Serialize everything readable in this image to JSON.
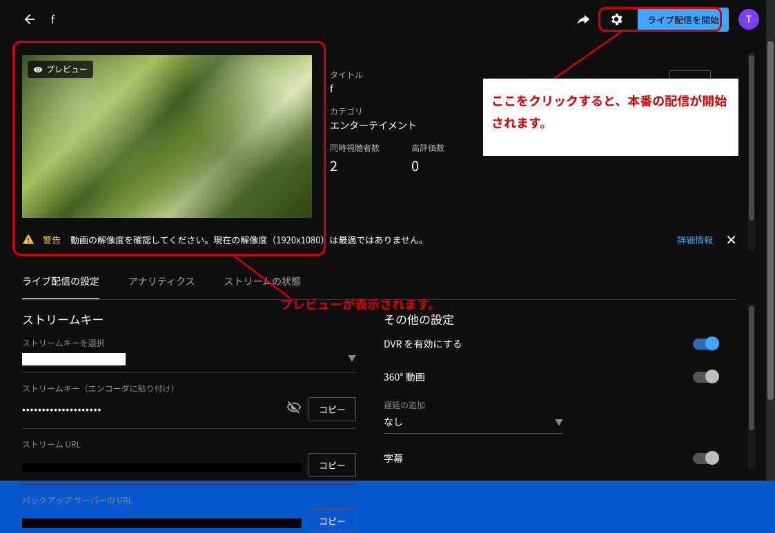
{
  "topbar": {
    "stream_title": "f",
    "go_live_label": "ライブ配信を開始",
    "avatar_initial": "T"
  },
  "preview": {
    "badge": "プレビュー"
  },
  "meta": {
    "title_label": "タイトル",
    "title_value": "f",
    "category_label": "カテゴリ",
    "category_value": "エンターテイメント",
    "viewers_label": "同時視聴者数",
    "viewers_value": "2",
    "likes_label": "高評価数",
    "likes_value": "0"
  },
  "warning": {
    "tag": "警告",
    "message": "動画の解像度を確認してください。現在の解像度（1920x1080）は最適ではありません。",
    "learn_more": "詳細情報"
  },
  "tabs": {
    "settings": "ライブ配信の設定",
    "analytics": "アナリティクス",
    "health": "ストリームの状態"
  },
  "stream_key": {
    "heading": "ストリームキー",
    "select_label": "ストリームキーを選択",
    "key_label": "ストリームキー（エンコーダに貼り付け）",
    "key_masked": "••••••••••••••••••••",
    "url_label": "ストリーム URL",
    "backup_label": "バックアップ サーバーの URL",
    "copy_label": "コピー"
  },
  "other": {
    "heading": "その他の設定",
    "dvr_label": "DVR を有効にする",
    "video360_label": "360° 動画",
    "latency_label": "遅延の追加",
    "latency_value": "なし",
    "cc_label": "字幕"
  },
  "annotations": {
    "note_golive": "ここをクリックすると、本番の配信が開始されます。",
    "note_preview": "プレビューが表示されます。"
  }
}
